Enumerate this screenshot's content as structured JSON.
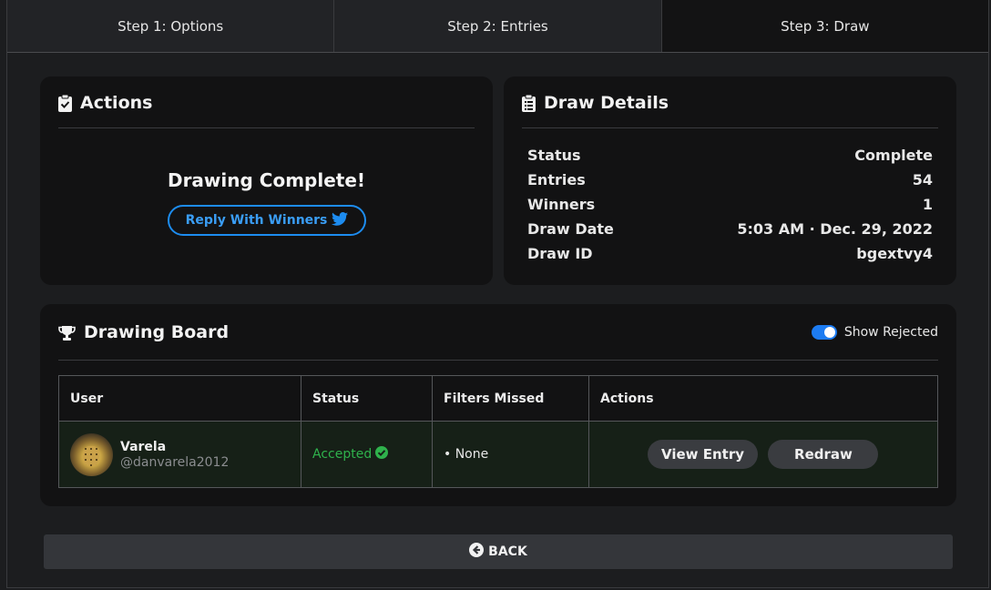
{
  "tabs": [
    {
      "label": "Step 1: Options"
    },
    {
      "label": "Step 2: Entries"
    },
    {
      "label": "Step 3: Draw"
    }
  ],
  "actions_card": {
    "title": "Actions",
    "icon": "clipboard-check-icon",
    "complete_text": "Drawing Complete!",
    "reply_button_label": "Reply With Winners",
    "reply_icon": "twitter-icon"
  },
  "details_card": {
    "title": "Draw Details",
    "icon": "clipboard-list-icon",
    "rows": [
      {
        "label": "Status",
        "value": "Complete"
      },
      {
        "label": "Entries",
        "value": "54"
      },
      {
        "label": "Winners",
        "value": "1"
      },
      {
        "label": "Draw Date",
        "value": "5:03 AM · Dec. 29, 2022"
      },
      {
        "label": "Draw ID",
        "value": "bgextvy4"
      }
    ]
  },
  "board": {
    "title": "Drawing Board",
    "icon": "trophy-icon",
    "toggle_label": "Show Rejected",
    "toggle_on": true,
    "columns": [
      "User",
      "Status",
      "Filters Missed",
      "Actions"
    ],
    "rows": [
      {
        "name": "Varela",
        "handle": "@danvarela2012",
        "status": "Accepted",
        "filters_missed": "• None",
        "view_label": "View Entry",
        "redraw_label": "Redraw"
      }
    ]
  },
  "back_label": "BACK",
  "colors": {
    "accent": "#1d8cf0",
    "accepted": "#2fb24c",
    "card_bg": "#121213",
    "page_bg": "#1c1d1f"
  }
}
